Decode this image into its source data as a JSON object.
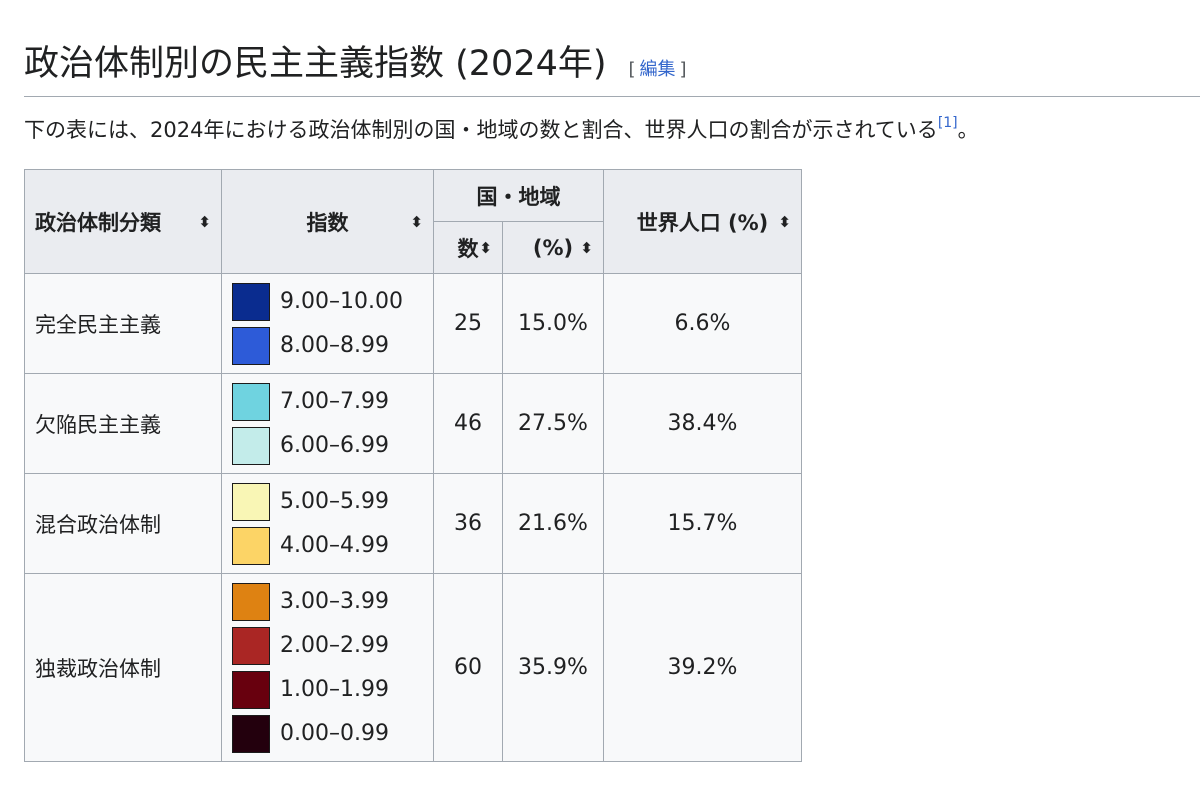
{
  "heading": {
    "title": "政治体制別の民主主義指数 (2024年)",
    "edit_open": "[",
    "edit_label": "編集",
    "edit_close": "]"
  },
  "intro": {
    "text": "下の表には、2024年における政治体制別の国・地域の数と割合、世界人口の割合が示されている",
    "ref": "[1]",
    "end": "。"
  },
  "table": {
    "headers": {
      "type": "政治体制分類",
      "index": "指数",
      "countries": "国・地域",
      "count": "数",
      "percent": "(%)",
      "population": "世界人口 (%)"
    },
    "sort_icon": "sort-icon",
    "rows": [
      {
        "type": "完全民主主義",
        "count": "25",
        "percent": "15.0%",
        "population": "6.6%",
        "legend": [
          {
            "color": "#0a2c8f",
            "label": "9.00–10.00"
          },
          {
            "color": "#2d5bd8",
            "label": "8.00–8.99"
          }
        ]
      },
      {
        "type": "欠陥民主主義",
        "count": "46",
        "percent": "27.5%",
        "population": "38.4%",
        "legend": [
          {
            "color": "#6fd3e0",
            "label": "7.00–7.99"
          },
          {
            "color": "#c3ecea",
            "label": "6.00–6.99"
          }
        ]
      },
      {
        "type": "混合政治体制",
        "count": "36",
        "percent": "21.6%",
        "population": "15.7%",
        "legend": [
          {
            "color": "#f9f6b5",
            "label": "5.00–5.99"
          },
          {
            "color": "#fcd466",
            "label": "4.00–4.99"
          }
        ]
      },
      {
        "type": "独裁政治体制",
        "count": "60",
        "percent": "35.9%",
        "population": "39.2%",
        "legend": [
          {
            "color": "#de8212",
            "label": "3.00–3.99"
          },
          {
            "color": "#aa2624",
            "label": "2.00–2.99"
          },
          {
            "color": "#68000e",
            "label": "1.00–1.99"
          },
          {
            "color": "#23000d",
            "label": "0.00–0.99"
          }
        ]
      }
    ]
  }
}
